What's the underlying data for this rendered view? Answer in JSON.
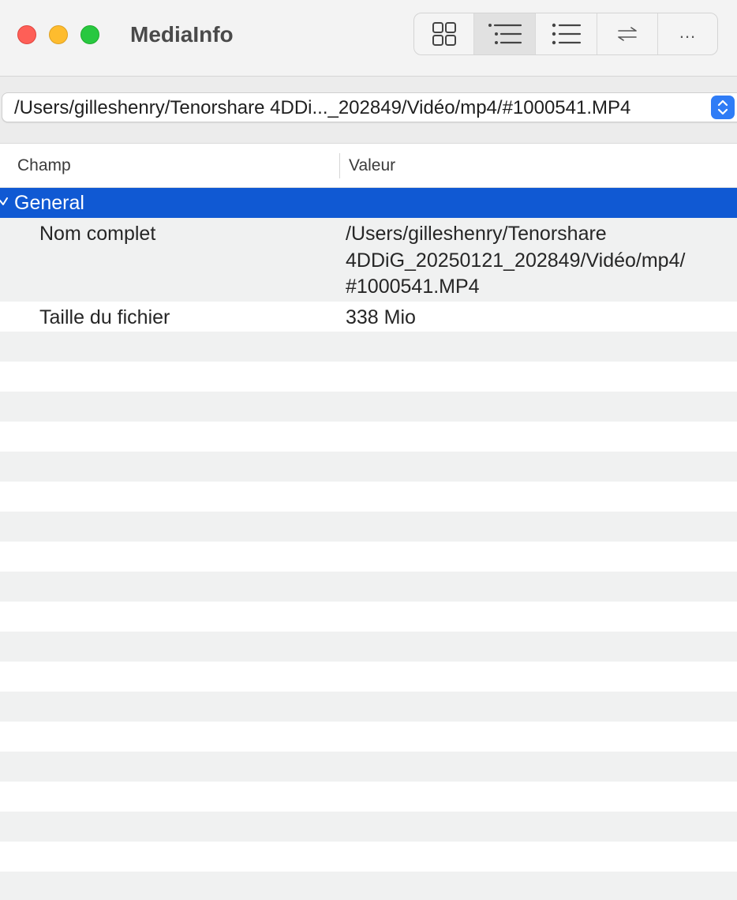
{
  "window": {
    "title": "MediaInfo"
  },
  "toolbar": {
    "buttons": [
      {
        "name": "view-grid",
        "icon": "grid-icon"
      },
      {
        "name": "view-tree",
        "icon": "tree-list-icon",
        "active": true
      },
      {
        "name": "view-list",
        "icon": "bullet-list-icon"
      },
      {
        "name": "compare",
        "icon": "swap-arrows-icon"
      },
      {
        "name": "more",
        "icon": "ellipsis-icon",
        "label": "..."
      }
    ]
  },
  "file_selector": {
    "path": "/Users/gilleshenry/Tenorshare 4DDi..._202849/Vidéo/mp4/#1000541.MP4",
    "icon": "chevron-up-down-icon",
    "accent": "#2f7cf6"
  },
  "table": {
    "columns": {
      "field": "Champ",
      "value": "Valeur"
    },
    "group": {
      "label": "General",
      "color": "#1059d3"
    },
    "rows": [
      {
        "field": "Nom complet",
        "value": "/Users/gilleshenry/Tenorshare 4DDiG_20250121_202849/Vidéo/mp4/ #1000541.MP4"
      },
      {
        "field": "Taille du fichier",
        "value": "338 Mio"
      }
    ]
  }
}
